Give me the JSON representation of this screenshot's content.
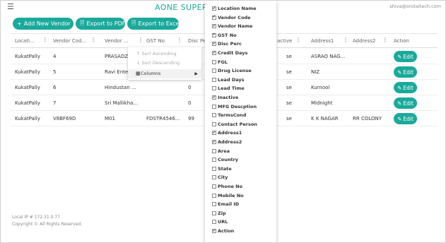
{
  "topbar": {
    "menu_icon": "hamburger-icon",
    "title": "AONE SUPERMA",
    "user_email": "shiva@orotaitech.com"
  },
  "toolbar": {
    "add_label": "Add New Vendor",
    "pdf_label": "Export to PDF",
    "excel_label": "Export to Excel"
  },
  "grid": {
    "columns": [
      "Locati...",
      "Vendor Cod...",
      "Vendor ...",
      "GST No",
      "Disc Pe",
      "active",
      "Address1",
      "Address2",
      "Action"
    ],
    "rows": [
      {
        "location": "KukatPally",
        "code": "4",
        "name": "PRASADZ",
        "gst": "",
        "disc": "",
        "active": "se",
        "address1": "ASRAO NAG...",
        "address2": "",
        "action": "Edit"
      },
      {
        "location": "KukatPally",
        "code": "5",
        "name": "Ravi Ente",
        "gst": "",
        "disc": "",
        "active": "se",
        "address1": "NIZ",
        "address2": "",
        "action": "Edit"
      },
      {
        "location": "KukatPally",
        "code": "6",
        "name": "Hindustan ...",
        "gst": "",
        "disc": "0",
        "active": "se",
        "address1": "Kurnool",
        "address2": "",
        "action": "Edit"
      },
      {
        "location": "KukatPally",
        "code": "7",
        "name": "Sri Mallikha...",
        "gst": "",
        "disc": "0",
        "active": "se",
        "address1": "Midnight",
        "address2": "",
        "action": "Edit"
      },
      {
        "location": "KukatPally",
        "code": "V8BF69D",
        "name": "M01",
        "gst": "FDSTR4546...",
        "disc": "99",
        "active": "se",
        "address1": "K K NAGAR",
        "address2": "RR COLONY",
        "action": "Edit"
      }
    ]
  },
  "column_menu": {
    "sort_asc": "Sort Ascending",
    "sort_desc": "Sort Descending",
    "columns": "Columns"
  },
  "column_chooser": [
    {
      "label": "Location Name",
      "checked": true
    },
    {
      "label": "Vendor Code",
      "checked": true
    },
    {
      "label": "Vendor Name",
      "checked": true
    },
    {
      "label": "GST No",
      "checked": true
    },
    {
      "label": "Disc Perc",
      "checked": true
    },
    {
      "label": "Credit Days",
      "checked": true
    },
    {
      "label": "FGL",
      "checked": false
    },
    {
      "label": "Drug License",
      "checked": false
    },
    {
      "label": "Lead Days",
      "checked": false
    },
    {
      "label": "Lead Time",
      "checked": false
    },
    {
      "label": "Inactive",
      "checked": true
    },
    {
      "label": "MFG Descption",
      "checked": false
    },
    {
      "label": "TermsCond",
      "checked": false
    },
    {
      "label": "Contact Person",
      "checked": false
    },
    {
      "label": "Address1",
      "checked": true
    },
    {
      "label": "Address2",
      "checked": true
    },
    {
      "label": "Area",
      "checked": false
    },
    {
      "label": "Country",
      "checked": false
    },
    {
      "label": "State",
      "checked": false
    },
    {
      "label": "City",
      "checked": false
    },
    {
      "label": "Phone No",
      "checked": false
    },
    {
      "label": "Mobile No",
      "checked": false
    },
    {
      "label": "Email ID",
      "checked": false
    },
    {
      "label": "Zip",
      "checked": false
    },
    {
      "label": "URL",
      "checked": false
    },
    {
      "label": "Action",
      "checked": true
    }
  ],
  "footer": {
    "local_ip": "Local IP # 172.31.0.77",
    "copyright": "Copyright © All Rights Reserved."
  },
  "colors": {
    "accent": "#1ba99a"
  }
}
